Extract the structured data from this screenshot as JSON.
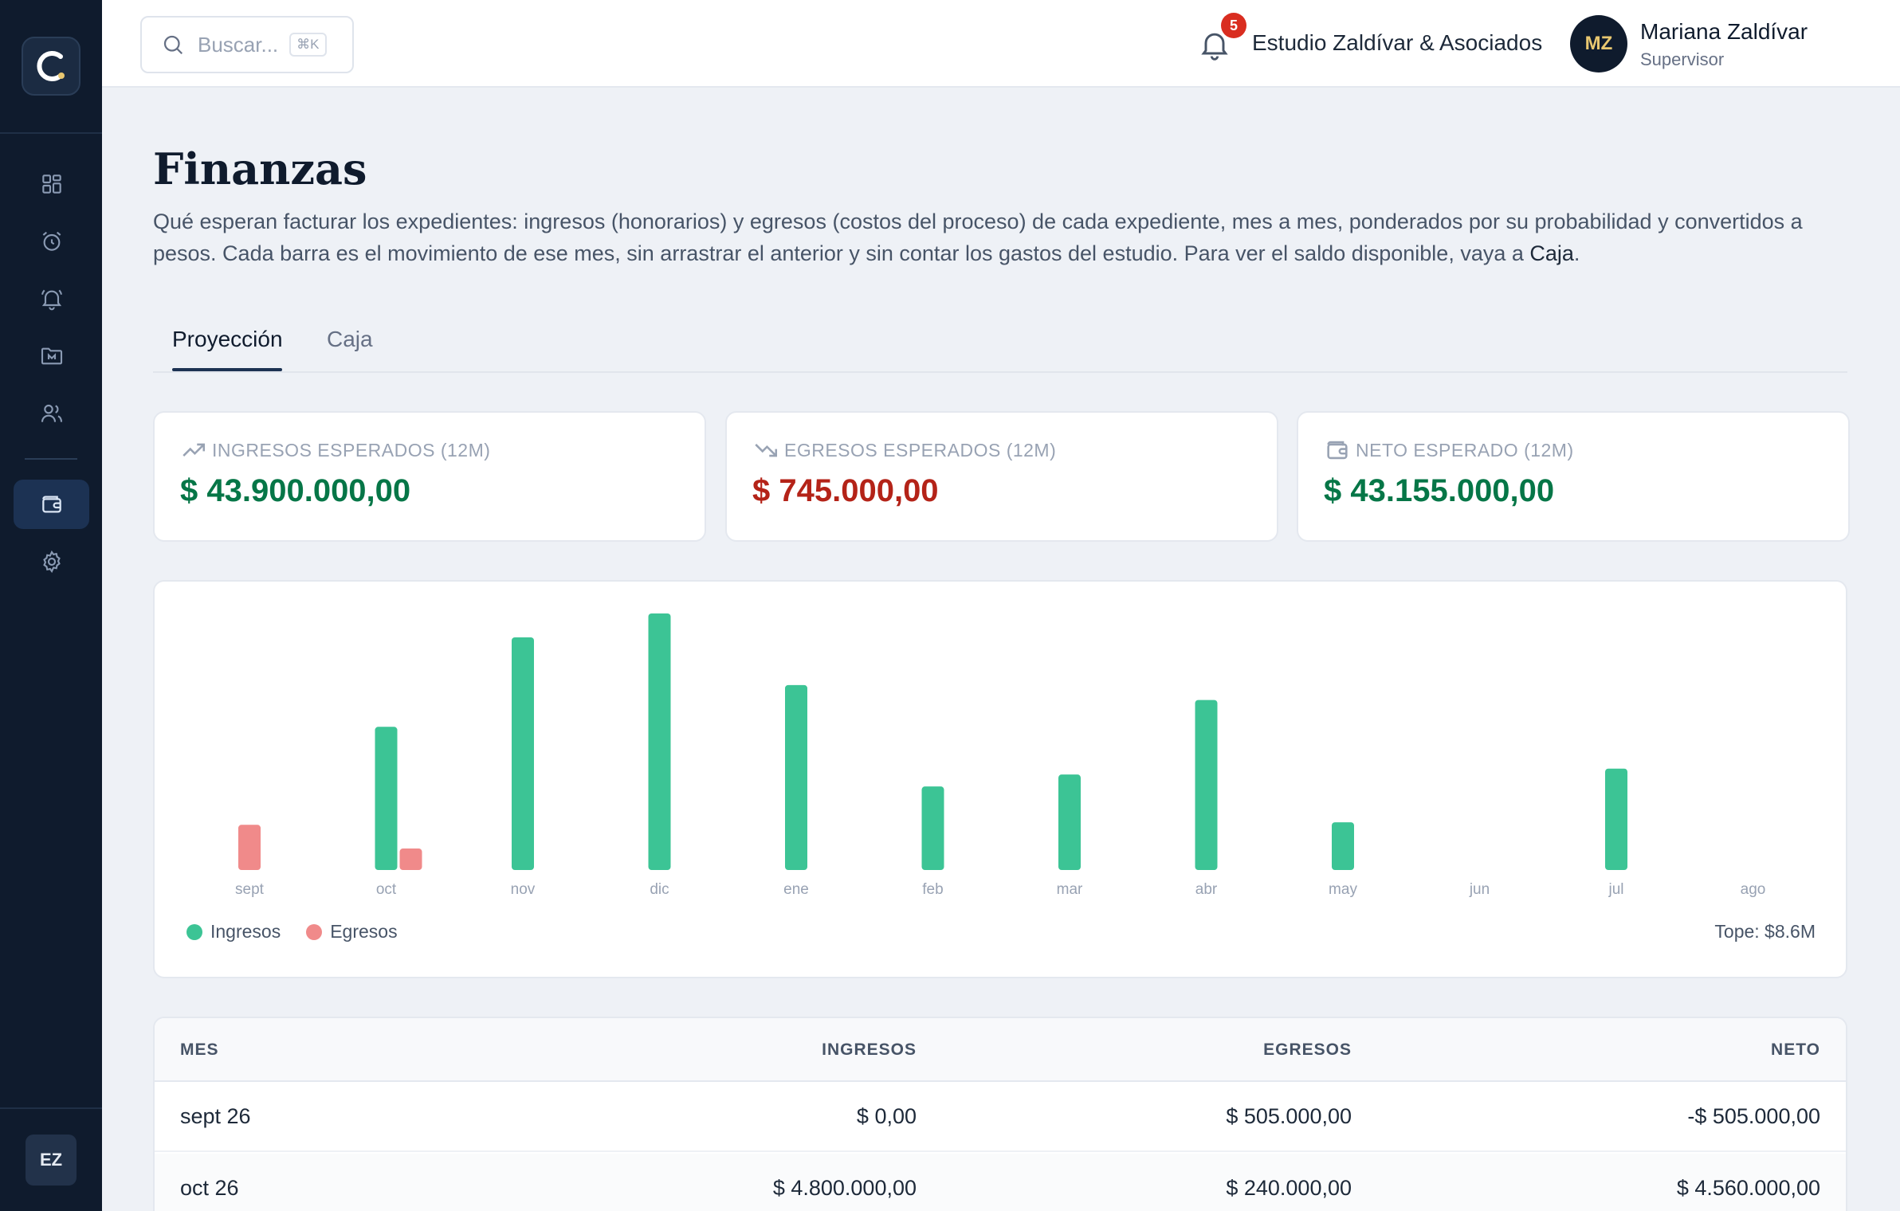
{
  "sidebar": {
    "user_initials": "EZ",
    "items": [
      {
        "icon": "grid-icon"
      },
      {
        "icon": "alarm-clock-icon"
      },
      {
        "icon": "bell-ring-icon"
      },
      {
        "icon": "folder-icon"
      },
      {
        "icon": "users-icon"
      },
      {
        "icon": "wallet-icon",
        "active": true
      },
      {
        "icon": "gear-icon"
      }
    ]
  },
  "topbar": {
    "search_placeholder": "Buscar...",
    "search_shortcut": "⌘K",
    "notifications_count": "5",
    "studio_name": "Estudio Zaldívar & Asociados",
    "user_initials": "MZ",
    "user_name": "Mariana Zaldívar",
    "user_role": "Supervisor"
  },
  "page": {
    "title": "Finanzas",
    "description_main": "Qué esperan facturar los expedientes: ingresos (honorarios) y egresos (costos del proceso) de cada expediente, mes a mes, ponderados por su probabilidad y convertidos a pesos. Cada barra es el movimiento de ese mes, sin arrastrar el anterior y sin contar los gastos del estudio. Para ver el saldo disponible, vaya a ",
    "description_link": "Caja",
    "description_end": "."
  },
  "tabs": [
    {
      "label": "Proyección",
      "active": true
    },
    {
      "label": "Caja",
      "active": false
    }
  ],
  "kpis": [
    {
      "label": "INGRESOS ESPERADOS (12M)",
      "value": "$ 43.900.000,00",
      "icon": "trending-up-icon",
      "color": "#067647"
    },
    {
      "label": "EGRESOS ESPERADOS (12M)",
      "value": "$ 745.000,00",
      "icon": "trending-down-icon",
      "color": "#b42318"
    },
    {
      "label": "NETO ESPERADO (12M)",
      "value": "$ 43.155.000,00",
      "icon": "wallet-icon",
      "color": "#067647"
    }
  ],
  "chart_data": {
    "type": "bar",
    "categories": [
      "sept",
      "oct",
      "nov",
      "dic",
      "ene",
      "feb",
      "mar",
      "abr",
      "may",
      "jun",
      "jul",
      "ago"
    ],
    "series": [
      {
        "name": "Ingresos",
        "color": "#3cc495",
        "values": [
          0,
          4800000,
          7800000,
          8600000,
          6200000,
          2800000,
          3200000,
          5700000,
          1600000,
          0,
          3400000,
          0
        ]
      },
      {
        "name": "Egresos",
        "color": "#f08a8a",
        "values": [
          505000,
          240000,
          0,
          0,
          0,
          0,
          0,
          0,
          0,
          0,
          0,
          0
        ]
      }
    ],
    "ylim": [
      0,
      8600000
    ],
    "cap_label": "Tope: $8.6M",
    "grid": false,
    "legend": "bottom-left"
  },
  "table": {
    "headers": {
      "mes": "MES",
      "ingresos": "INGRESOS",
      "egresos": "EGRESOS",
      "neto": "NETO"
    },
    "rows": [
      {
        "mes": "sept 26",
        "ingresos": "$ 0,00",
        "egresos": "$ 505.000,00",
        "neto": "-$ 505.000,00"
      },
      {
        "mes": "oct 26",
        "ingresos": "$ 4.800.000,00",
        "egresos": "$ 240.000,00",
        "neto": "$ 4.560.000,00"
      }
    ]
  }
}
